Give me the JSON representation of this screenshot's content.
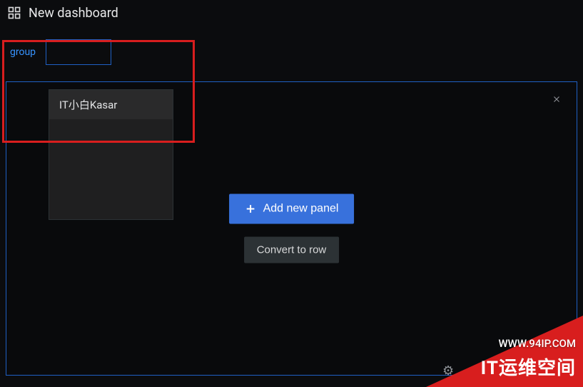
{
  "header": {
    "title": "New dashboard"
  },
  "variable": {
    "label": "group",
    "value": ""
  },
  "dropdown": {
    "items": [
      "IT小白Kasar"
    ]
  },
  "panel": {
    "addLabel": "Add new panel",
    "convertLabel": "Convert to row"
  },
  "watermark": {
    "url": "WWW.94IP.COM",
    "text": "IT运维空间"
  }
}
